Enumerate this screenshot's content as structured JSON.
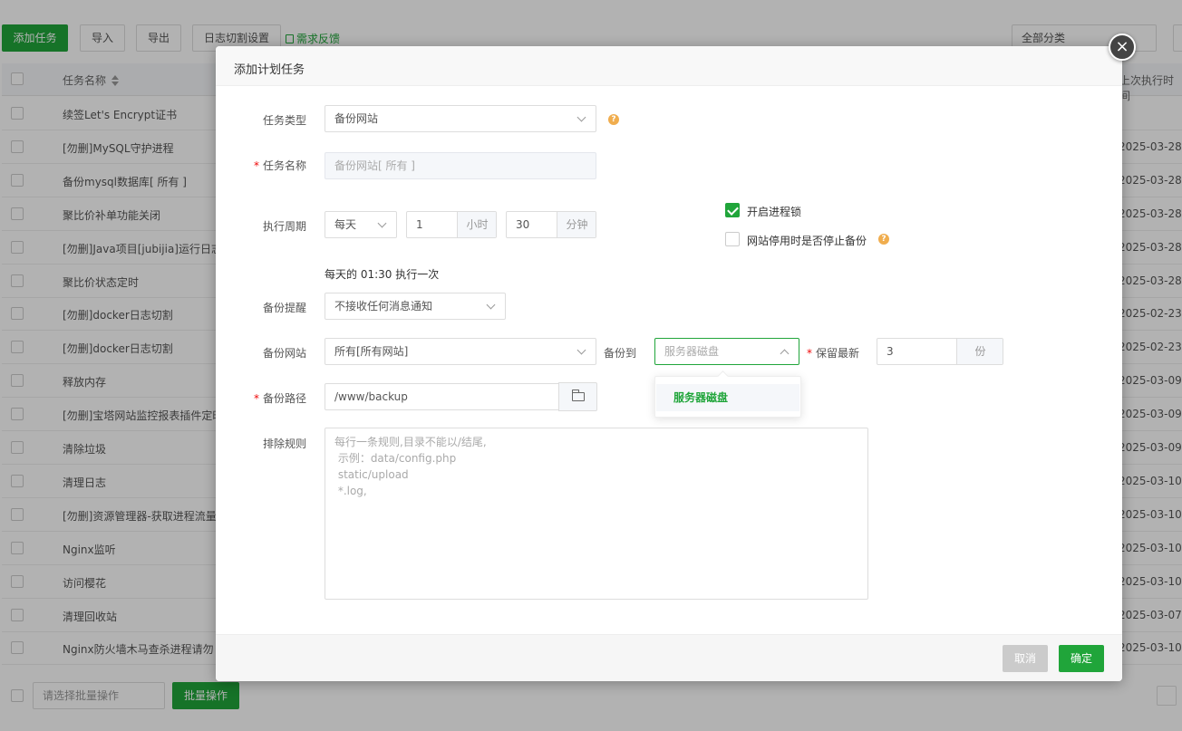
{
  "toolbar": {
    "add_task": "添加任务",
    "import": "导入",
    "export": "导出",
    "log_split": "日志切割设置",
    "feedback": "需求反馈",
    "category": "全部分类"
  },
  "table": {
    "col_name": "任务名称",
    "col_last_run": "上次执行时间",
    "rows": [
      {
        "name": "续签Let's Encrypt证书",
        "date": ""
      },
      {
        "name": "[勿删]MySQL守护进程",
        "date": "2025-03-28"
      },
      {
        "name": "备份mysql数据库[ 所有 ]",
        "date": "2025-03-28"
      },
      {
        "name": "聚比价补单功能关闭",
        "date": "2025-03-28"
      },
      {
        "name": "[勿删]Java项目[jubijia]运行日志",
        "date": "2025-03-28"
      },
      {
        "name": "聚比价状态定时",
        "date": "2025-03-28"
      },
      {
        "name": "[勿删]docker日志切割",
        "date": "2025-02-23"
      },
      {
        "name": "[勿删]docker日志切割",
        "date": "2025-02-23"
      },
      {
        "name": "释放内存",
        "date": "2025-03-09"
      },
      {
        "name": "[勿删]宝塔网站监控报表插件定时",
        "date": "2025-03-09"
      },
      {
        "name": "清除垃圾",
        "date": "2025-03-09"
      },
      {
        "name": "清理日志",
        "date": "2025-03-10"
      },
      {
        "name": "[勿删]资源管理器-获取进程流量",
        "date": "2025-03-10"
      },
      {
        "name": "Nginx监听",
        "date": "2025-03-10"
      },
      {
        "name": "访问樱花",
        "date": "2025-03-10"
      },
      {
        "name": "清理回收站",
        "date": "2025-03-07"
      },
      {
        "name": "Nginx防火墙木马查杀进程请勿",
        "date": "2025-03-10"
      }
    ]
  },
  "footer": {
    "batch_placeholder": "请选择批量操作",
    "batch_button": "批量操作"
  },
  "modal": {
    "title": "添加计划任务",
    "close": "×",
    "task_type_label": "任务类型",
    "task_type_value": "备份网站",
    "task_name_label": "任务名称",
    "task_name_placeholder": "备份网站[ 所有 ]",
    "cycle_label": "执行周期",
    "cycle_value": "每天",
    "hour_value": "1",
    "hour_unit": "小时",
    "minute_value": "30",
    "minute_unit": "分钟",
    "process_lock": "开启进程锁",
    "stop_backup_when_disabled": "网站停用时是否停止备份",
    "cycle_hint": "每天的 01:30 执行一次",
    "notify_label": "备份提醒",
    "notify_value": "不接收任何消息通知",
    "site_label": "备份网站",
    "site_value": "所有[所有网站]",
    "backup_to_label": "备份到",
    "backup_to_placeholder": "服务器磁盘",
    "keep_label": "保留最新",
    "keep_value": "3",
    "keep_unit": "份",
    "path_label": "备份路径",
    "path_value": "/www/backup",
    "exclude_label": "排除规则",
    "exclude_placeholder": "每行一条规则,目录不能以/结尾,\n 示例：data/config.php\n static/upload\n *.log,",
    "dropdown_option": "服务器磁盘",
    "cancel": "取消",
    "confirm": "确定",
    "help_glyph": "?"
  }
}
